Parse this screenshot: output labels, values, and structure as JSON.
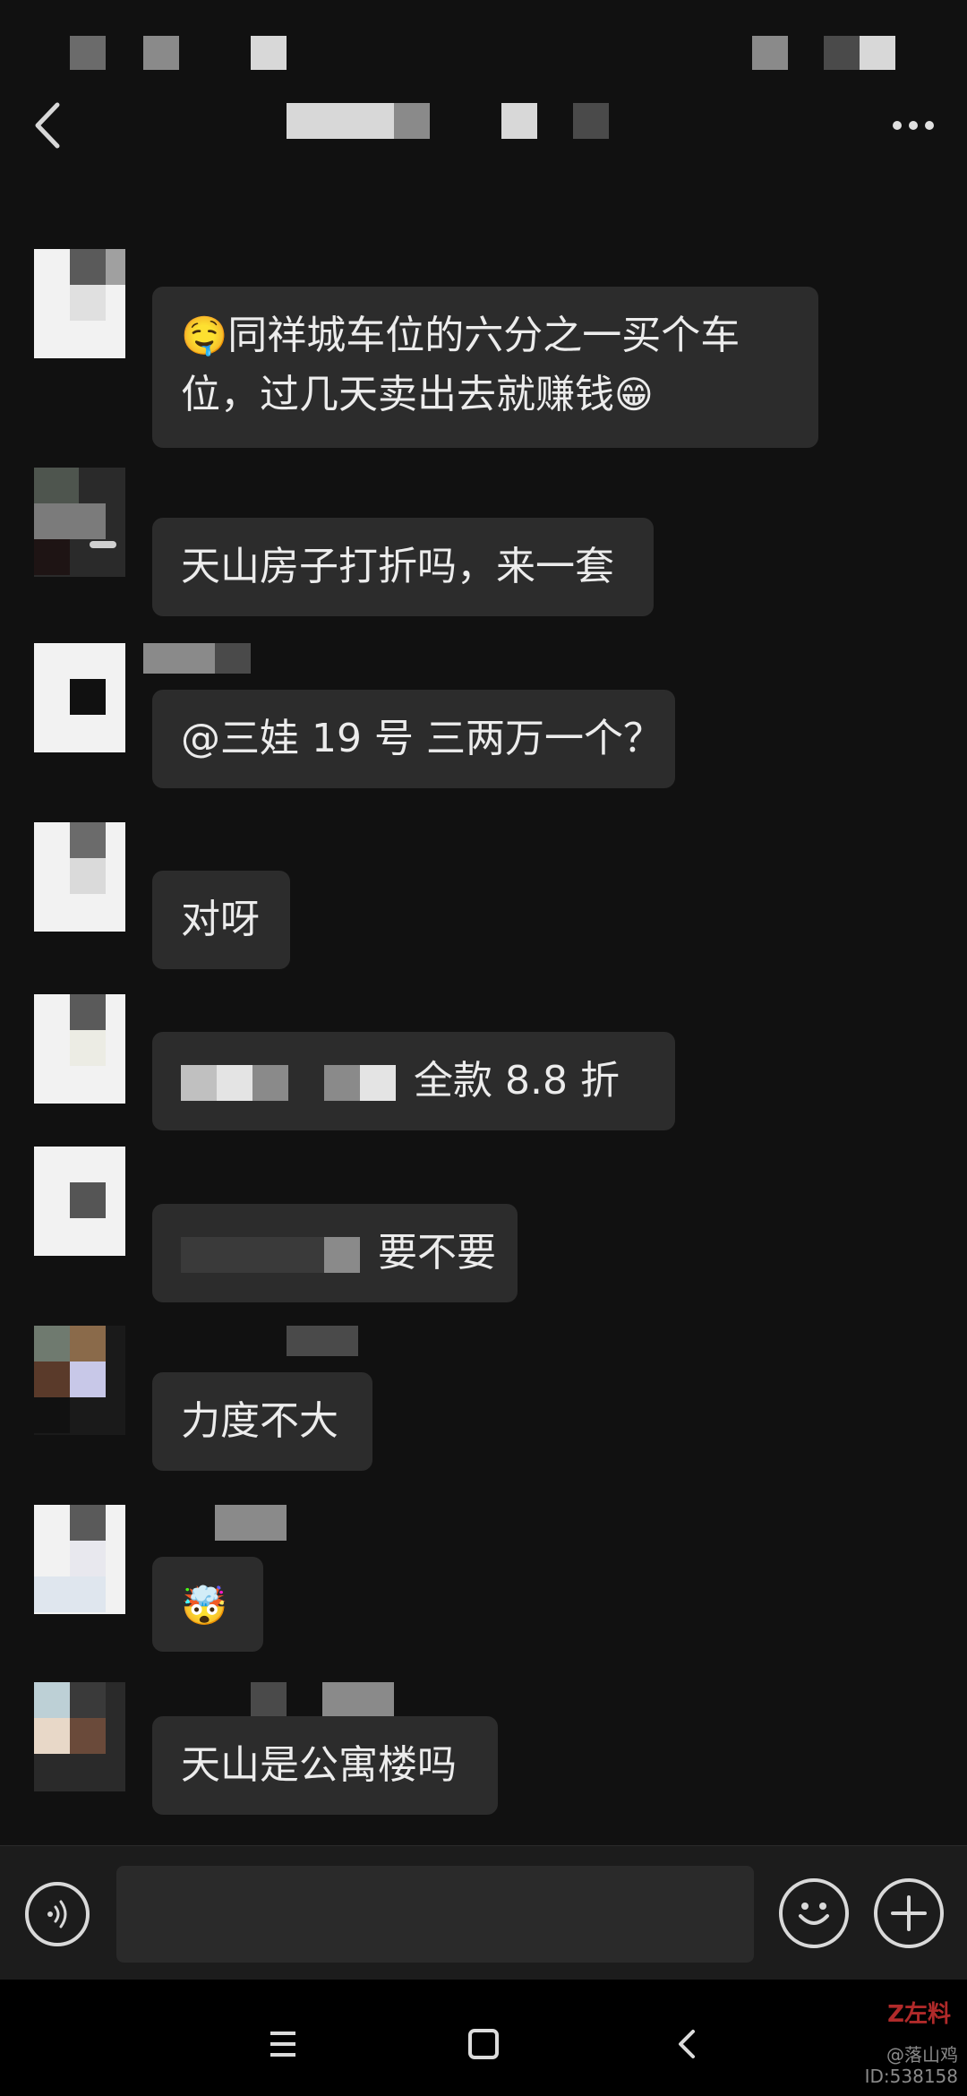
{
  "header": {
    "back_icon": "chevron-left-icon",
    "more_icon": "more-dots-icon"
  },
  "messages": [
    {
      "text_parts": [
        "🤤",
        "同祥城车位的六分之一买个车",
        "位，过几天卖出去就赚钱",
        "😁"
      ]
    },
    {
      "text": "天山房子打折吗，来一套"
    },
    {
      "text": "@三娃 19 号  三两万一个？"
    },
    {
      "text": "对呀"
    },
    {
      "text": "全款 8.8 折"
    },
    {
      "text": "要不要"
    },
    {
      "text": "力度不大"
    },
    {
      "emoji": "🤯"
    },
    {
      "text": "天山是公寓楼吗"
    }
  ],
  "input_bar": {
    "voice_icon": "voice-icon",
    "emoji_icon": "smile-icon",
    "plus_icon": "plus-icon"
  },
  "nav_bar": {
    "menu_icon": "menu-icon",
    "home_icon": "home-square-icon",
    "back_icon": "back-triangle-icon"
  },
  "watermark": {
    "logo": "Z左料",
    "name": "@落山鸡",
    "id": "ID:538158"
  }
}
